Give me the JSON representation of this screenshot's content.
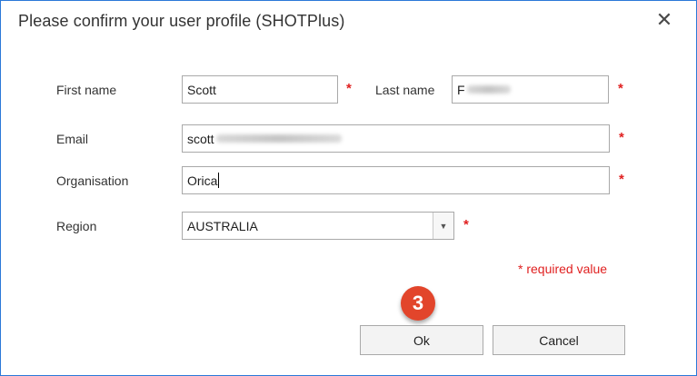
{
  "dialog": {
    "title": "Please confirm your user profile (SHOTPlus)",
    "close_icon": "close-icon"
  },
  "form": {
    "first_name": {
      "label": "First name",
      "value": "Scott"
    },
    "last_name": {
      "label": "Last name",
      "value": "F"
    },
    "email": {
      "label": "Email",
      "value": "scott"
    },
    "organisation": {
      "label": "Organisation",
      "value": "Orica"
    },
    "region": {
      "label": "Region",
      "value": "AUSTRALIA"
    },
    "required_mark": "*"
  },
  "required_note": "* required value",
  "step_badge": "3",
  "buttons": {
    "ok": "Ok",
    "cancel": "Cancel"
  },
  "colors": {
    "accent_border": "#2b79d8",
    "required": "#e02020",
    "badge": "#e2452b"
  }
}
